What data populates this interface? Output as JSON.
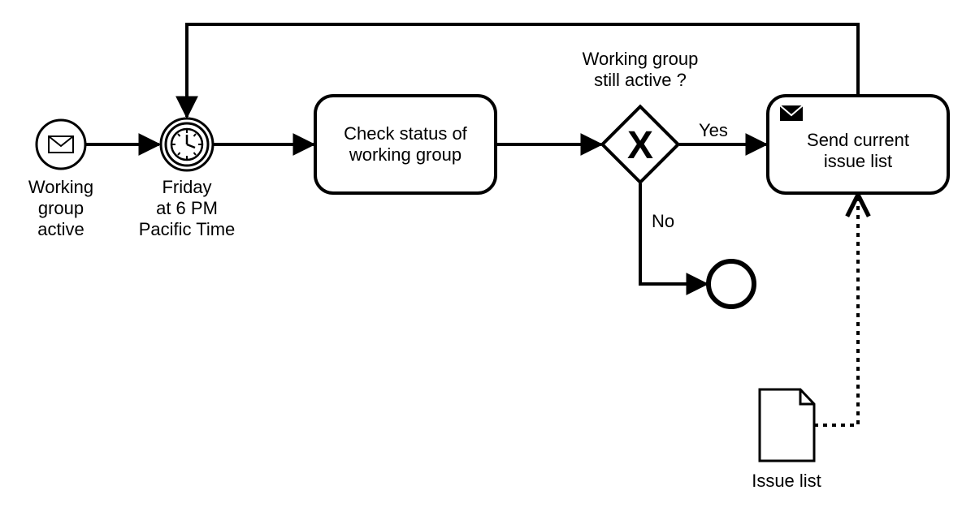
{
  "diagram": {
    "start_event": {
      "label_l1": "Working",
      "label_l2": "group",
      "label_l3": "active"
    },
    "timer_event": {
      "label_l1": "Friday",
      "label_l2": "at 6 PM",
      "label_l3": "Pacific Time"
    },
    "task_check": {
      "label_l1": "Check status of",
      "label_l2": "working group"
    },
    "gateway": {
      "question_l1": "Working group",
      "question_l2": "still active ?",
      "yes": "Yes",
      "no": "No"
    },
    "task_send": {
      "label_l1": "Send current",
      "label_l2": "issue list"
    },
    "data_object": {
      "label": "Issue list"
    }
  }
}
